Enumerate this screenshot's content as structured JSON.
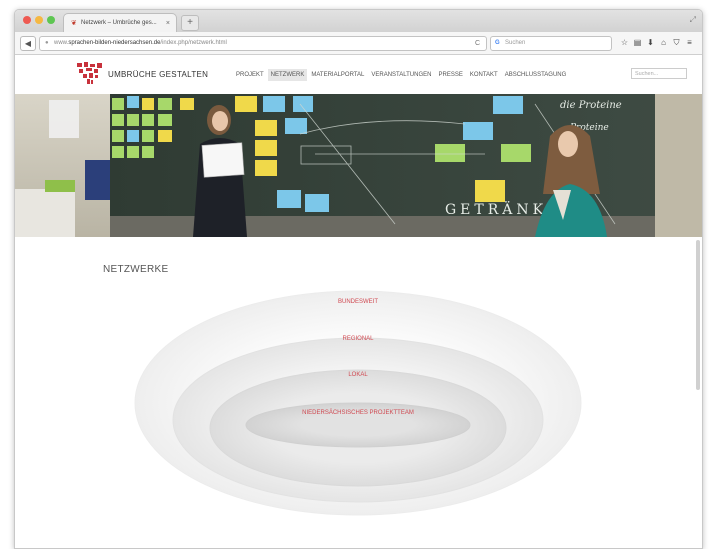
{
  "browser": {
    "tab_title": "Netzwerk – Umbrüche ges...",
    "tab_close": "×",
    "new_tab": "+",
    "url_prefix": "www.",
    "url_domain": "sprachen-bilden-niedersachsen.de",
    "url_path": "/index.php/netzwerk.html",
    "reload": "C",
    "search_engine": "G",
    "search_placeholder": "Suchen",
    "tool_icons": [
      "star-icon",
      "clipboard-icon",
      "download-icon",
      "home-icon",
      "shield-icon",
      "menu-icon"
    ]
  },
  "site": {
    "brand": "UMBRÜCHE GESTALTEN",
    "nav": [
      "PROJEKT",
      "NETZWERK",
      "MATERIALPORTAL",
      "VERANSTALTUNGEN",
      "PRESSE",
      "KONTAKT",
      "ABSCHLUSSTAGUNG"
    ],
    "active_nav": "NETZWERK",
    "search_placeholder": "Suchen...",
    "accent_color": "#d04a52"
  },
  "hero": {
    "board_words": [
      "die Proteine",
      "Proteine",
      "GETRÄNKE"
    ]
  },
  "page": {
    "title": "NETZWERKE",
    "levels": [
      "BUNDESWEIT",
      "REGIONAL",
      "LOKAL",
      "NIEDERSÄCHSISCHES PROJEKTTEAM"
    ]
  }
}
